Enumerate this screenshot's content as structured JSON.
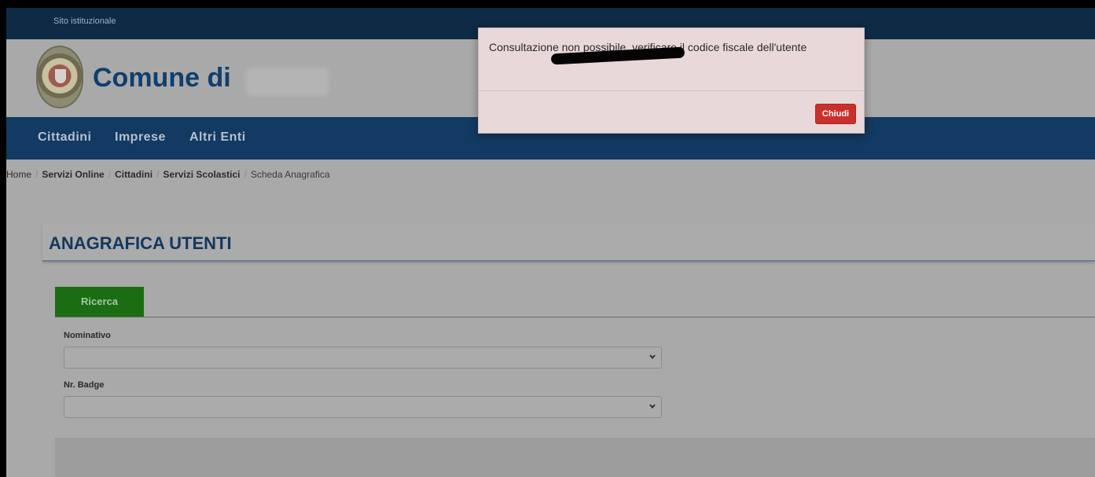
{
  "topbar": {
    "site_label": "Sito istituzionale"
  },
  "header": {
    "title": "Comune di"
  },
  "nav": {
    "items": [
      "Cittadini",
      "Imprese",
      "Altri Enti"
    ]
  },
  "breadcrumb": {
    "items": [
      "Home",
      "Servizi Online",
      "Cittadini",
      "Servizi Scolastici"
    ],
    "current": "Scheda Anagrafica"
  },
  "panel": {
    "title": "ANAGRAFICA UTENTI"
  },
  "tabs": {
    "search": "Ricerca"
  },
  "form": {
    "nominativo_label": "Nominativo",
    "nominativo_value": "",
    "badge_label": "Nr. Badge",
    "badge_value": ""
  },
  "modal": {
    "message": "Consultazione non possibile, verificare il codice fiscale dell'utente",
    "close_label": "Chiudi"
  },
  "colors": {
    "topbar": "#0f2a45",
    "nav": "#123a62",
    "tab_active": "#1a6d12",
    "close_button": "#c9302c"
  }
}
